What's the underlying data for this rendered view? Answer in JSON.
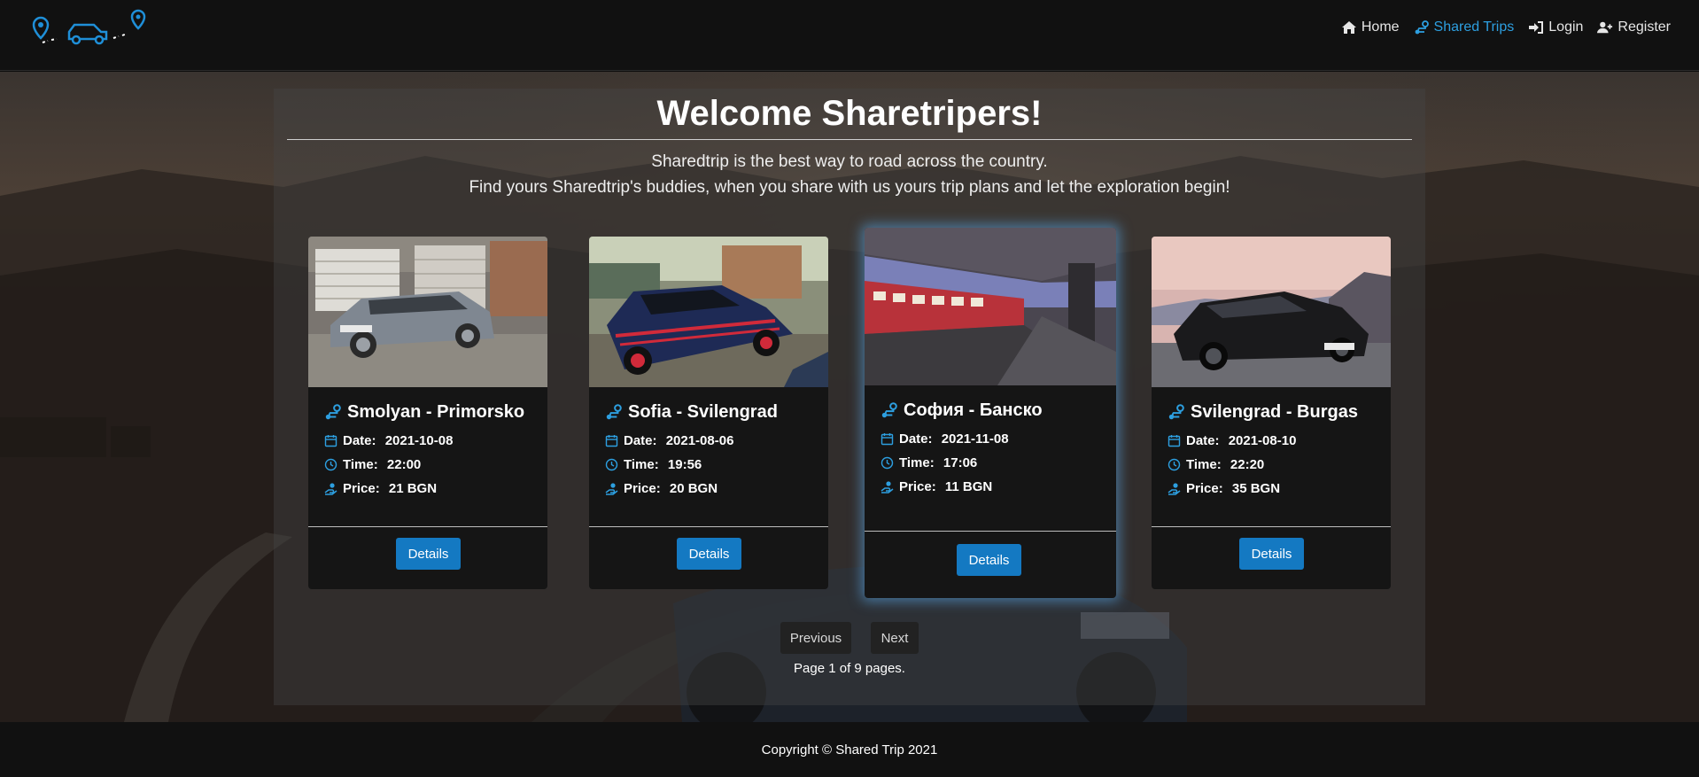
{
  "nav": {
    "items": [
      {
        "label": "Home",
        "icon": "home-icon"
      },
      {
        "label": "Shared Trips",
        "icon": "route-icon",
        "active": true
      },
      {
        "label": "Login",
        "icon": "sign-in-icon"
      },
      {
        "label": "Register",
        "icon": "user-plus-icon"
      }
    ]
  },
  "main": {
    "title": "Welcome Sharetripers!",
    "tagline_1": "Sharedtrip is the best way to road across the country.",
    "tagline_2": "Find yours Sharedtrip's buddies, when you share with us yours trip plans and let the exploration begin!"
  },
  "labels": {
    "date": "Date:",
    "time": "Time:",
    "price": "Price:",
    "details": "Details"
  },
  "trips": [
    {
      "route": "Smolyan - Primorsko",
      "date": "2021-10-08",
      "time": "22:00",
      "price": "21 BGN",
      "image": "silver-audi-sedan-photo"
    },
    {
      "route": "Sofia - Svilengrad",
      "date": "2021-08-06",
      "time": "19:56",
      "price": "20 BGN",
      "image": "blue-dacia-car-photo"
    },
    {
      "route": "София - Банско",
      "date": "2021-11-08",
      "time": "17:06",
      "price": "11 BGN",
      "image": "train-platform-photo"
    },
    {
      "route": "Svilengrad - Burgas",
      "date": "2021-08-10",
      "time": "22:20",
      "price": "35 BGN",
      "image": "black-mercedes-coupe-photo"
    }
  ],
  "pagination": {
    "previous": "Previous",
    "next": "Next",
    "info": "Page 1 of 9 pages."
  },
  "footer": {
    "copyright": "Copyright © Shared Trip 2021"
  },
  "colors": {
    "accent": "#1479c2",
    "active_link": "#2d9fe0",
    "navbar": "#111111",
    "card": "#151515"
  }
}
